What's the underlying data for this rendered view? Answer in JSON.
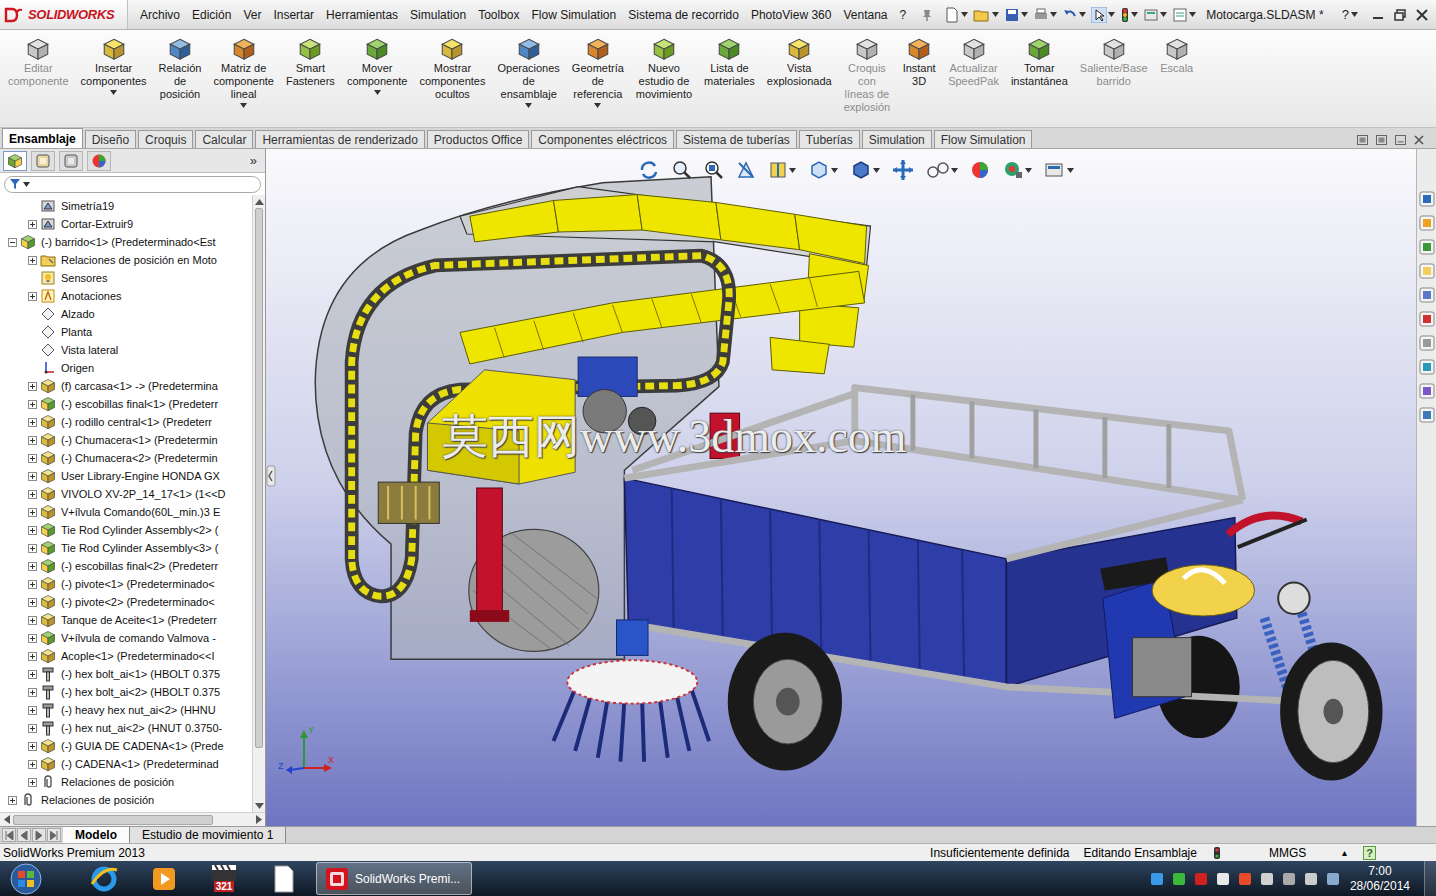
{
  "app": {
    "logo": "SOLIDWORKS",
    "document": "Motocarga.SLDASM *",
    "help": "?"
  },
  "menu": [
    "Archivo",
    "Edición",
    "Ver",
    "Insertar",
    "Herramientas",
    "Simulation",
    "Toolbox",
    "Flow Simulation",
    "Sistema de recorrido",
    "PhotoView 360",
    "Ventana",
    "?"
  ],
  "ribbon": [
    {
      "lines": [
        "Editar",
        "componente"
      ],
      "disabled": true,
      "dropdown": false
    },
    {
      "lines": [
        "Insertar",
        "componentes"
      ],
      "disabled": false,
      "dropdown": true
    },
    {
      "lines": [
        "Relación",
        "de",
        "posición"
      ],
      "disabled": false,
      "dropdown": false
    },
    {
      "lines": [
        "Matriz de",
        "componente",
        "lineal"
      ],
      "disabled": false,
      "dropdown": true
    },
    {
      "lines": [
        "Smart",
        "Fasteners"
      ],
      "disabled": false,
      "dropdown": false
    },
    {
      "lines": [
        "Mover",
        "componente"
      ],
      "disabled": false,
      "dropdown": true
    },
    {
      "lines": [
        "Mostrar",
        "componentes",
        "ocultos"
      ],
      "disabled": false,
      "dropdown": false
    },
    {
      "lines": [
        "Operaciones",
        "de",
        "ensamblaje"
      ],
      "disabled": false,
      "dropdown": true
    },
    {
      "lines": [
        "Geometría",
        "de",
        "referencia"
      ],
      "disabled": false,
      "dropdown": true
    },
    {
      "lines": [
        "Nuevo",
        "estudio de",
        "movimiento"
      ],
      "disabled": false,
      "dropdown": false
    },
    {
      "lines": [
        "Lista de",
        "materiales"
      ],
      "disabled": false,
      "dropdown": false
    },
    {
      "lines": [
        "Vista",
        "explosionada"
      ],
      "disabled": false,
      "dropdown": false
    },
    {
      "lines": [
        "Croquis",
        "con",
        "líneas de",
        "explosión"
      ],
      "disabled": true,
      "dropdown": false
    },
    {
      "lines": [
        "Instant",
        "3D"
      ],
      "disabled": false,
      "dropdown": false
    },
    {
      "lines": [
        "Actualizar",
        "SpeedPak"
      ],
      "disabled": true,
      "dropdown": false
    },
    {
      "lines": [
        "Tomar",
        "instantánea"
      ],
      "disabled": false,
      "dropdown": false
    },
    {
      "lines": [
        "Saliente/Base",
        "barrido"
      ],
      "disabled": true,
      "dropdown": false
    },
    {
      "lines": [
        "Escala"
      ],
      "disabled": true,
      "dropdown": false
    }
  ],
  "command_tabs": [
    {
      "label": "Ensamblaje",
      "selected": true
    },
    {
      "label": "Diseño",
      "selected": false
    },
    {
      "label": "Croquis",
      "selected": false
    },
    {
      "label": "Calcular",
      "selected": false
    },
    {
      "label": "Herramientas de renderizado",
      "selected": false
    },
    {
      "label": "Productos Office",
      "selected": false
    },
    {
      "label": "Componentes eléctricos",
      "selected": false
    },
    {
      "label": "Sistema de tuberías",
      "selected": false
    },
    {
      "label": "Tuberías",
      "selected": false
    },
    {
      "label": "Simulation",
      "selected": false
    },
    {
      "label": "Flow Simulation",
      "selected": false
    }
  ],
  "feature_tree": {
    "more": "»",
    "panel_tabs": [
      {
        "kind": "feature-manager",
        "selected": true
      },
      {
        "kind": "property-manager",
        "selected": false
      },
      {
        "kind": "configuration-manager",
        "selected": false
      },
      {
        "kind": "display-manager",
        "selected": false
      }
    ],
    "items": [
      {
        "label": "Simetría19",
        "level": 1,
        "kind": "feature",
        "expandable": false,
        "expanded": false
      },
      {
        "label": "Cortar-Extruir9",
        "level": 1,
        "kind": "feature",
        "expandable": true,
        "expanded": false
      },
      {
        "label": "(-) barrido<1> (Predeterminado<Est",
        "level": 0,
        "kind": "assembly",
        "expandable": true,
        "expanded": true
      },
      {
        "label": "Relaciones de posición en Moto",
        "level": 1,
        "kind": "folder",
        "expandable": true,
        "expanded": false
      },
      {
        "label": "Sensores",
        "level": 1,
        "kind": "sensor",
        "expandable": false,
        "expanded": false
      },
      {
        "label": "Anotaciones",
        "level": 1,
        "kind": "annotation",
        "expandable": true,
        "expanded": false
      },
      {
        "label": "Alzado",
        "level": 1,
        "kind": "plane",
        "expandable": false,
        "expanded": false
      },
      {
        "label": "Planta",
        "level": 1,
        "kind": "plane",
        "expandable": false,
        "expanded": false
      },
      {
        "label": "Vista lateral",
        "level": 1,
        "kind": "plane",
        "expandable": false,
        "expanded": false
      },
      {
        "label": "Origen",
        "level": 1,
        "kind": "origin",
        "expandable": false,
        "expanded": false
      },
      {
        "label": "(f) carcasa<1> -> (Predetermina",
        "level": 1,
        "kind": "part",
        "expandable": true,
        "expanded": false
      },
      {
        "label": "(-) escobillas final<1> (Predeterr",
        "level": 1,
        "kind": "assembly",
        "expandable": true,
        "expanded": false
      },
      {
        "label": "(-) rodillo central<1> (Predeterr",
        "level": 1,
        "kind": "part",
        "expandable": true,
        "expanded": false
      },
      {
        "label": "(-) Chumacera<1> (Predetermin",
        "level": 1,
        "kind": "part",
        "expandable": true,
        "expanded": false
      },
      {
        "label": "(-) Chumacera<2> (Predetermin",
        "level": 1,
        "kind": "part",
        "expandable": true,
        "expanded": false
      },
      {
        "label": "User Library-Engine HONDA GX",
        "level": 1,
        "kind": "part",
        "expandable": true,
        "expanded": false
      },
      {
        "label": "VIVOLO XV-2P_14_17<1> (1<<D",
        "level": 1,
        "kind": "part",
        "expandable": true,
        "expanded": false
      },
      {
        "label": "V+ílvula Comando(60L_min.)3 E",
        "level": 1,
        "kind": "part",
        "expandable": true,
        "expanded": false
      },
      {
        "label": "Tie Rod Cylinder Assembly<2> (",
        "level": 1,
        "kind": "assembly",
        "expandable": true,
        "expanded": false
      },
      {
        "label": "Tie Rod Cylinder Assembly<3> (",
        "level": 1,
        "kind": "assembly",
        "expandable": true,
        "expanded": false
      },
      {
        "label": "(-) escobillas final<2> (Predeterr",
        "level": 1,
        "kind": "assembly",
        "expandable": true,
        "expanded": false
      },
      {
        "label": "(-) pivote<1> (Predeterminado<",
        "level": 1,
        "kind": "part",
        "expandable": true,
        "expanded": false
      },
      {
        "label": "(-) pivote<2> (Predeterminado<",
        "level": 1,
        "kind": "part",
        "expandable": true,
        "expanded": false
      },
      {
        "label": "Tanque de Aceite<1> (Predeterr",
        "level": 1,
        "kind": "part",
        "expandable": true,
        "expanded": false
      },
      {
        "label": "V+ílvula de comando Valmova -",
        "level": 1,
        "kind": "assembly",
        "expandable": true,
        "expanded": false
      },
      {
        "label": "Acople<1> (Predeterminado<<I",
        "level": 1,
        "kind": "part",
        "expandable": true,
        "expanded": false
      },
      {
        "label": "(-) hex bolt_ai<1> (HBOLT 0.375",
        "level": 1,
        "kind": "fastener",
        "expandable": true,
        "expanded": false
      },
      {
        "label": "(-) hex bolt_ai<2> (HBOLT 0.375",
        "level": 1,
        "kind": "fastener",
        "expandable": true,
        "expanded": false
      },
      {
        "label": "(-) heavy hex nut_ai<2> (HHNU",
        "level": 1,
        "kind": "fastener",
        "expandable": true,
        "expanded": false
      },
      {
        "label": "(-) hex nut_ai<2> (HNUT 0.3750-",
        "level": 1,
        "kind": "fastener",
        "expandable": true,
        "expanded": false
      },
      {
        "label": "(-) GUIA DE CADENA<1> (Prede",
        "level": 1,
        "kind": "part",
        "expandable": true,
        "expanded": false
      },
      {
        "label": "(-) CADENA<1> (Predeterminad",
        "level": 1,
        "kind": "part",
        "expandable": true,
        "expanded": false
      },
      {
        "label": "Relaciones de posición",
        "level": 1,
        "kind": "mates",
        "expandable": true,
        "expanded": false
      },
      {
        "label": "Relaciones de posición",
        "level": 0,
        "kind": "mates",
        "expandable": true,
        "expanded": false
      }
    ]
  },
  "viewport": {
    "watermark": "莫西网www.3dmox.com",
    "triad": [
      "X",
      "Y",
      "Z"
    ]
  },
  "bottom_tabs": [
    {
      "label": "Modelo",
      "selected": true
    },
    {
      "label": "Estudio de movimiento 1",
      "selected": false
    }
  ],
  "status_bar": {
    "product": "SolidWorks Premium 2013",
    "definition": "Insuficientemente definida",
    "mode": "Editando Ensamblaje",
    "units": "MMGS",
    "units_arrow": "▴",
    "help": "?"
  },
  "taskbar": {
    "pinned": [
      {
        "kind": "ie",
        "label": ""
      },
      {
        "kind": "media",
        "label": ""
      },
      {
        "kind": "calendar",
        "label": "321"
      },
      {
        "kind": "document",
        "label": ""
      }
    ],
    "windows": [
      {
        "label": "SolidWorks Premi...",
        "selected": true
      }
    ],
    "time": "7:00",
    "date": "28/06/2014"
  }
}
